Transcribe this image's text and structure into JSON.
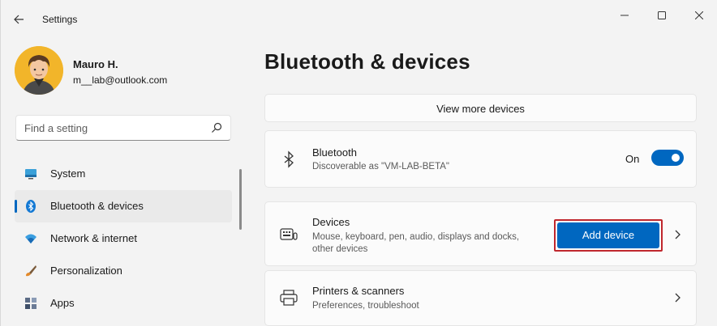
{
  "window": {
    "title": "Settings"
  },
  "profile": {
    "name": "Mauro H.",
    "email": "m__lab@outlook.com"
  },
  "search": {
    "placeholder": "Find a setting"
  },
  "nav": {
    "items": [
      {
        "label": "System",
        "icon": "system-icon"
      },
      {
        "label": "Bluetooth & devices",
        "icon": "bluetooth-icon",
        "active": true
      },
      {
        "label": "Network & internet",
        "icon": "wifi-icon"
      },
      {
        "label": "Personalization",
        "icon": "brush-icon"
      },
      {
        "label": "Apps",
        "icon": "apps-icon"
      }
    ]
  },
  "main": {
    "title": "Bluetooth & devices",
    "view_more": "View more devices",
    "bluetooth": {
      "title": "Bluetooth",
      "subtitle": "Discoverable as \"VM-LAB-BETA\"",
      "toggle_label": "On",
      "toggle_on": true
    },
    "devices": {
      "title": "Devices",
      "subtitle_line1": "Mouse, keyboard, pen, audio, displays and docks,",
      "subtitle_line2": "other devices",
      "button": "Add device"
    },
    "printers": {
      "title": "Printers & scanners",
      "subtitle": "Preferences, troubleshoot"
    }
  },
  "colors": {
    "accent": "#0067c0",
    "highlight_border": "#c0272d",
    "background": "#f3f3f3"
  }
}
